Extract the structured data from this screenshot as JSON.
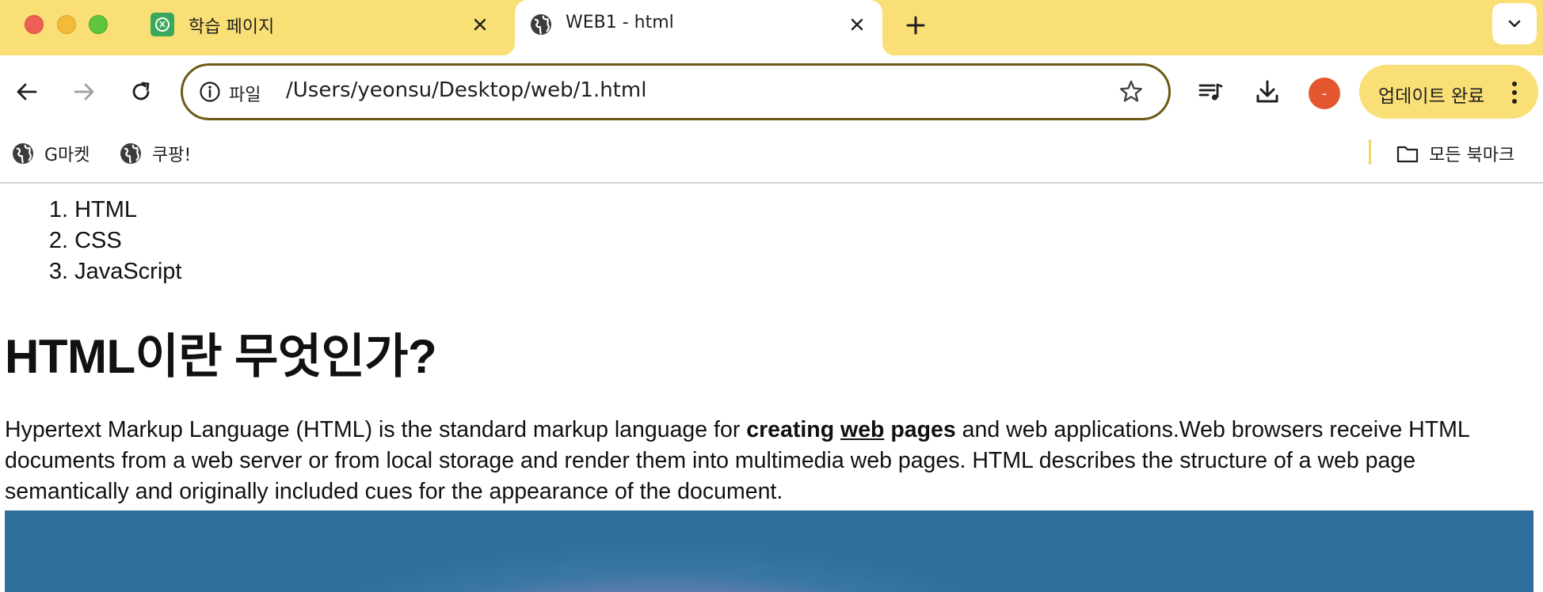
{
  "tabs": [
    {
      "title": "학습 페이지",
      "active": false,
      "favicon": "green-app-icon"
    },
    {
      "title": "WEB1 - html",
      "active": true,
      "favicon": "globe-icon"
    }
  ],
  "toolbar": {
    "scheme_label": "파일",
    "url": "/Users/yeonsu/Desktop/web/1.html",
    "avatar_text": "-",
    "update_label": "업데이트 완료"
  },
  "bookmarks": {
    "items": [
      {
        "label": "G마켓",
        "icon": "globe-icon"
      },
      {
        "label": "쿠팡!",
        "icon": "globe-icon"
      }
    ],
    "all_label": "모든 북마크"
  },
  "page": {
    "toc": [
      {
        "num": "1.",
        "label": "HTML"
      },
      {
        "num": "2.",
        "label": "CSS"
      },
      {
        "num": "3.",
        "label": "JavaScript"
      }
    ],
    "title": "HTML이란 무엇인가?",
    "paragraph": {
      "before": "Hypertext Markup Language (HTML) is the standard markup language for ",
      "bold1": "creating",
      "underline": "web",
      "bold2": "pages",
      "after": " and web applications.Web browsers receive HTML documents from a web server or from local storage and render them into multimedia web pages. HTML describes the structure of a web page semantically and originally included cues for the appearance of the document."
    }
  },
  "colors": {
    "tabstrip": "#f9df76",
    "omnibox_border": "#6b5a16",
    "avatar": "#e4572e",
    "image_blue": "#2f6f9e",
    "image_purple": "#b88ad8"
  }
}
